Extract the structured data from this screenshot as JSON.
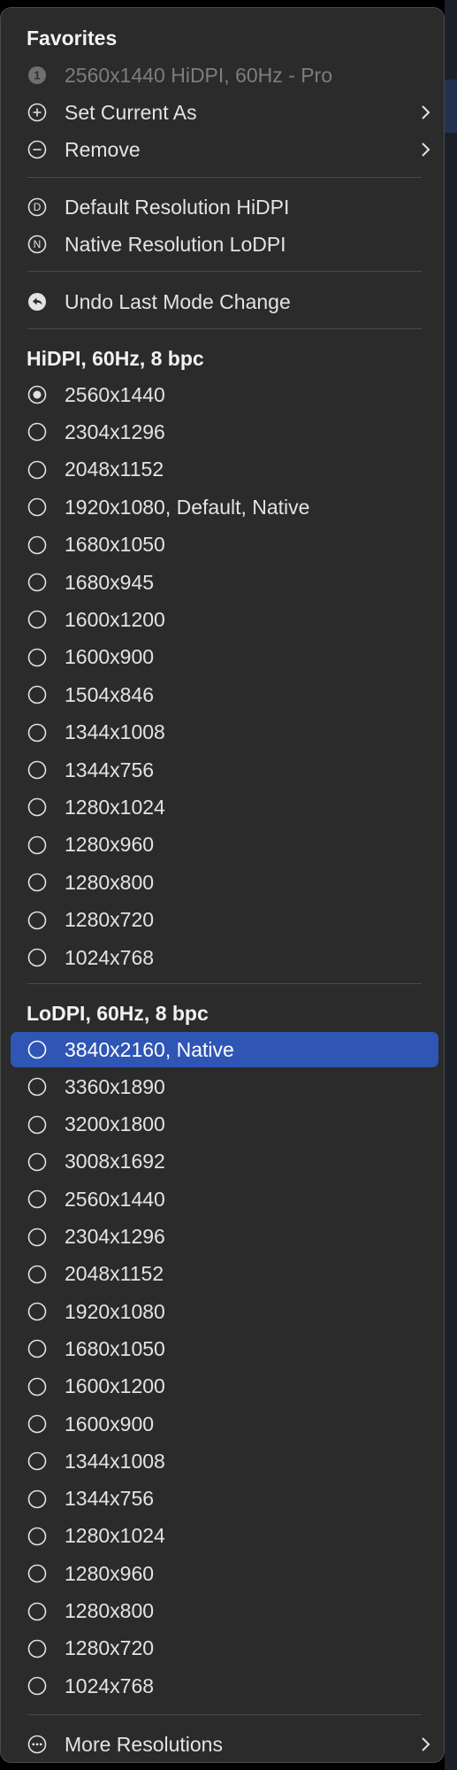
{
  "favorites": {
    "header": "Favorites",
    "current": "2560x1440 HiDPI, 60Hz - Pro",
    "set_current": "Set Current As",
    "remove": "Remove"
  },
  "defaults": {
    "default_hidpi": "Default Resolution HiDPI",
    "native_lodpi": "Native Resolution LoDPI",
    "undo": "Undo Last Mode Change"
  },
  "hidpi": {
    "header": "HiDPI, 60Hz, 8 bpc",
    "items": [
      {
        "label": "2560x1440",
        "selected": true
      },
      {
        "label": "2304x1296"
      },
      {
        "label": "2048x1152"
      },
      {
        "label": "1920x1080, Default, Native"
      },
      {
        "label": "1680x1050"
      },
      {
        "label": "1680x945"
      },
      {
        "label": "1600x1200"
      },
      {
        "label": "1600x900"
      },
      {
        "label": "1504x846"
      },
      {
        "label": "1344x1008"
      },
      {
        "label": "1344x756"
      },
      {
        "label": "1280x1024"
      },
      {
        "label": "1280x960"
      },
      {
        "label": "1280x800"
      },
      {
        "label": "1280x720"
      },
      {
        "label": "1024x768"
      }
    ]
  },
  "lodpi": {
    "header": "LoDPI, 60Hz, 8 bpc",
    "items": [
      {
        "label": "3840x2160, Native",
        "highlighted": true
      },
      {
        "label": "3360x1890"
      },
      {
        "label": "3200x1800"
      },
      {
        "label": "3008x1692"
      },
      {
        "label": "2560x1440"
      },
      {
        "label": "2304x1296"
      },
      {
        "label": "2048x1152"
      },
      {
        "label": "1920x1080"
      },
      {
        "label": "1680x1050"
      },
      {
        "label": "1600x1200"
      },
      {
        "label": "1600x900"
      },
      {
        "label": "1344x1008"
      },
      {
        "label": "1344x756"
      },
      {
        "label": "1280x1024"
      },
      {
        "label": "1280x960"
      },
      {
        "label": "1280x800"
      },
      {
        "label": "1280x720"
      },
      {
        "label": "1024x768"
      }
    ]
  },
  "more": {
    "label": "More Resolutions"
  },
  "colors": {
    "menu_bg": "#2b2b2b",
    "highlight": "#2f55b5",
    "text": "#e3e3e3",
    "disabled_text": "#7d7d7d",
    "separator": "#4b4b4b"
  }
}
